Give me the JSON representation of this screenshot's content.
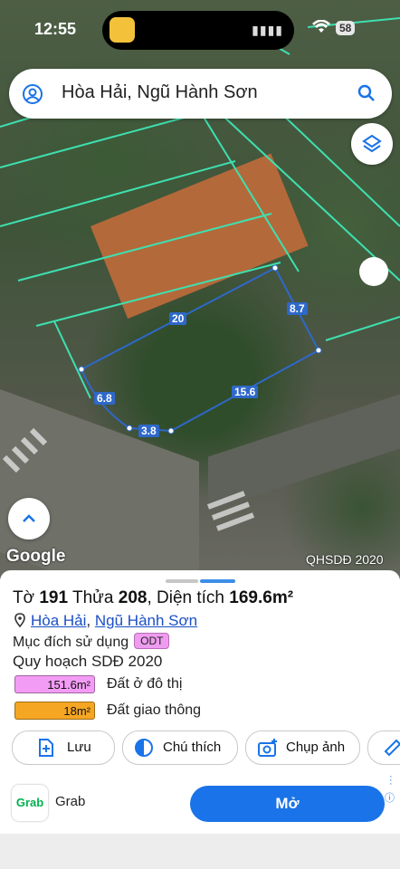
{
  "status_bar": {
    "time": "12:55",
    "battery": "58"
  },
  "search": {
    "query": "Hòa Hải, Ngũ Hành Sơn"
  },
  "map": {
    "edge_labels": [
      "20",
      "8.7",
      "6.8",
      "3.8",
      "15.6"
    ],
    "google_logo": "Google",
    "source_label": "QHSDĐ 2020",
    "parcel_outline_color": "#2e68c9",
    "grid_line_color": "#3ee0b0"
  },
  "parcel": {
    "to_label": "Tờ",
    "to_value": "191",
    "thua_label": "Thửa",
    "thua_value": "208",
    "area_label": "Diện tích",
    "area_value": "169.6m²",
    "address_ward": "Hòa Hải",
    "address_district": "Ngũ Hành Sơn",
    "address_sep": ",",
    "purpose_label": "Mục đích sử dụng",
    "purpose_code": "ODT",
    "plan_title": "Quy hoạch SDĐ 2020",
    "legend": [
      {
        "value": "151.6m²",
        "label": "Đất ở đô thị",
        "color": "#f39cf5"
      },
      {
        "value": "18m²",
        "label": "Đất giao thông",
        "color": "#f5a623"
      }
    ]
  },
  "actions": {
    "save": "Lưu",
    "note": "Chú thích",
    "photo": "Chụp ảnh"
  },
  "ad": {
    "brand_logo": "Grab",
    "brand_name": "Grab",
    "open": "Mở",
    "info_icon": "ⓘ"
  }
}
